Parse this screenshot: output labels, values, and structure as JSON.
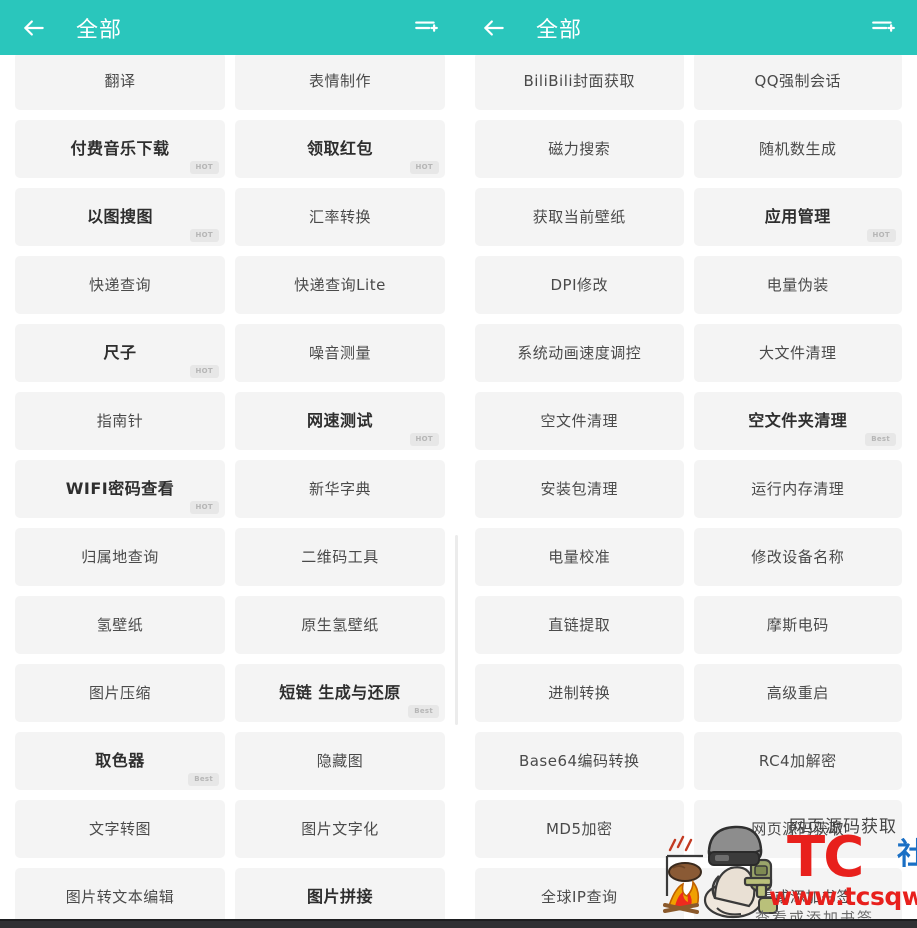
{
  "appbar": {
    "title": "全部",
    "back_icon": "arrow-left-icon",
    "action_icon": "playlist-add-icon"
  },
  "badges": {
    "hot": "HOT",
    "best": "Best"
  },
  "left_panel": {
    "items": [
      {
        "label": "翻译",
        "featured": false,
        "badge": ""
      },
      {
        "label": "表情制作",
        "featured": false,
        "badge": ""
      },
      {
        "label": "付费音乐下载",
        "featured": true,
        "badge": "HOT"
      },
      {
        "label": "领取红包",
        "featured": true,
        "badge": "HOT"
      },
      {
        "label": "以图搜图",
        "featured": true,
        "badge": "HOT"
      },
      {
        "label": "汇率转换",
        "featured": false,
        "badge": ""
      },
      {
        "label": "快递查询",
        "featured": false,
        "badge": ""
      },
      {
        "label": "快递查询Lite",
        "featured": false,
        "badge": ""
      },
      {
        "label": "尺子",
        "featured": true,
        "badge": "HOT"
      },
      {
        "label": "噪音测量",
        "featured": false,
        "badge": ""
      },
      {
        "label": "指南针",
        "featured": false,
        "badge": ""
      },
      {
        "label": "网速测试",
        "featured": true,
        "badge": "HOT"
      },
      {
        "label": "WIFI密码查看",
        "featured": true,
        "badge": "HOT"
      },
      {
        "label": "新华字典",
        "featured": false,
        "badge": ""
      },
      {
        "label": "归属地查询",
        "featured": false,
        "badge": ""
      },
      {
        "label": "二维码工具",
        "featured": false,
        "badge": ""
      },
      {
        "label": "氢壁纸",
        "featured": false,
        "badge": ""
      },
      {
        "label": "原生氢壁纸",
        "featured": false,
        "badge": ""
      },
      {
        "label": "图片压缩",
        "featured": false,
        "badge": ""
      },
      {
        "label": "短链 生成与还原",
        "featured": true,
        "badge": "Best"
      },
      {
        "label": "取色器",
        "featured": true,
        "badge": "Best"
      },
      {
        "label": "隐藏图",
        "featured": false,
        "badge": ""
      },
      {
        "label": "文字转图",
        "featured": false,
        "badge": ""
      },
      {
        "label": "图片文字化",
        "featured": false,
        "badge": ""
      },
      {
        "label": "图片转文本编辑",
        "featured": false,
        "badge": ""
      },
      {
        "label": "图片拼接",
        "featured": true,
        "badge": ""
      }
    ]
  },
  "right_panel": {
    "items": [
      {
        "label": "BiliBili封面获取",
        "featured": false,
        "badge": ""
      },
      {
        "label": "QQ强制会话",
        "featured": false,
        "badge": ""
      },
      {
        "label": "磁力搜索",
        "featured": false,
        "badge": ""
      },
      {
        "label": "随机数生成",
        "featured": false,
        "badge": ""
      },
      {
        "label": "获取当前壁纸",
        "featured": false,
        "badge": ""
      },
      {
        "label": "应用管理",
        "featured": true,
        "badge": "HOT"
      },
      {
        "label": "DPI修改",
        "featured": false,
        "badge": ""
      },
      {
        "label": "电量伪装",
        "featured": false,
        "badge": ""
      },
      {
        "label": "系统动画速度调控",
        "featured": false,
        "badge": ""
      },
      {
        "label": "大文件清理",
        "featured": false,
        "badge": ""
      },
      {
        "label": "空文件清理",
        "featured": false,
        "badge": ""
      },
      {
        "label": "空文件夹清理",
        "featured": true,
        "badge": "Best"
      },
      {
        "label": "安装包清理",
        "featured": false,
        "badge": ""
      },
      {
        "label": "运行内存清理",
        "featured": false,
        "badge": ""
      },
      {
        "label": "电量校准",
        "featured": false,
        "badge": ""
      },
      {
        "label": "修改设备名称",
        "featured": false,
        "badge": ""
      },
      {
        "label": "直链提取",
        "featured": false,
        "badge": ""
      },
      {
        "label": "摩斯电码",
        "featured": false,
        "badge": ""
      },
      {
        "label": "进制转换",
        "featured": false,
        "badge": ""
      },
      {
        "label": "高级重启",
        "featured": false,
        "badge": ""
      },
      {
        "label": "Base64编码转换",
        "featured": false,
        "badge": ""
      },
      {
        "label": "RC4加解密",
        "featured": false,
        "badge": ""
      },
      {
        "label": "MD5加密",
        "featured": false,
        "badge": ""
      },
      {
        "label": "网页源码获取",
        "featured": false,
        "badge": ""
      },
      {
        "label": "全球IP查询",
        "featured": false,
        "badge": ""
      },
      {
        "label": "查看或添加书签",
        "featured": false,
        "badge": ""
      }
    ]
  },
  "watermark": {
    "top_text": "网页源码获取",
    "logo_text": "TC",
    "logo_suffix": "社区",
    "url": "www.tcsqw.com",
    "sub_text": "查看或添加书签"
  },
  "theme": {
    "appbar_color": "#2ac6bc",
    "card_color": "#f4f4f4",
    "badge_color": "#e7e7e7",
    "watermark_red": "#e8201c",
    "watermark_blue": "#1a6fc4"
  }
}
